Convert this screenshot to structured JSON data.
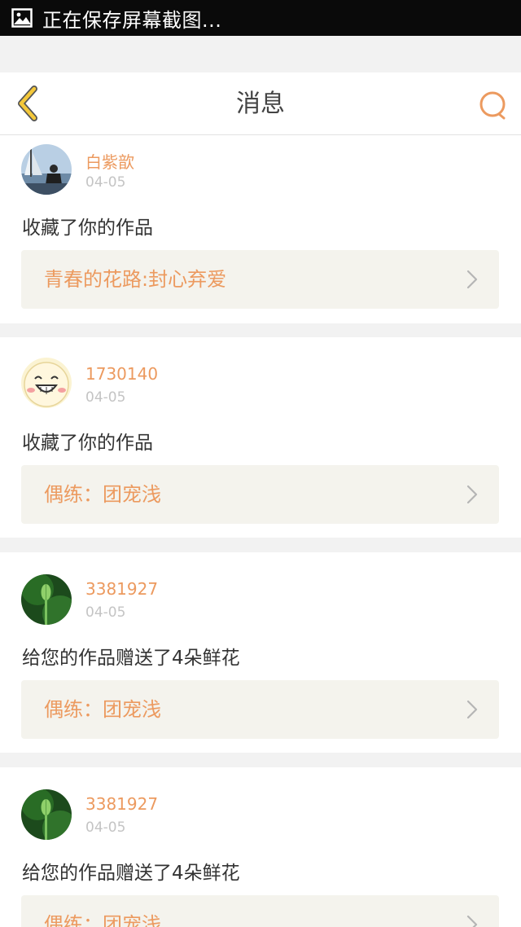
{
  "status_bar": {
    "text": "正在保存屏幕截图..."
  },
  "header": {
    "title": "消息"
  },
  "messages": [
    {
      "username": "白紫歆",
      "date": "04-05",
      "action": "收藏了你的作品",
      "work": "青春的花路:封心弃爱",
      "avatar": "sailboat-photo"
    },
    {
      "username": "1730140",
      "date": "04-05",
      "action": "收藏了你的作品",
      "work": "偶练：团宠浅",
      "avatar": "smiley-face"
    },
    {
      "username": "3381927",
      "date": "04-05",
      "action": "给您的作品赠送了4朵鲜花",
      "work": "偶练：团宠浅",
      "avatar": "lotus-bud"
    },
    {
      "username": "3381927",
      "date": "04-05",
      "action": "给您的作品赠送了4朵鲜花",
      "work": "偶练：团宠浅",
      "avatar": "lotus-bud"
    }
  ],
  "colors": {
    "accent": "#ec9a5f",
    "back_icon": "#f4c83a",
    "card_link_bg": "#f4f3ed"
  }
}
